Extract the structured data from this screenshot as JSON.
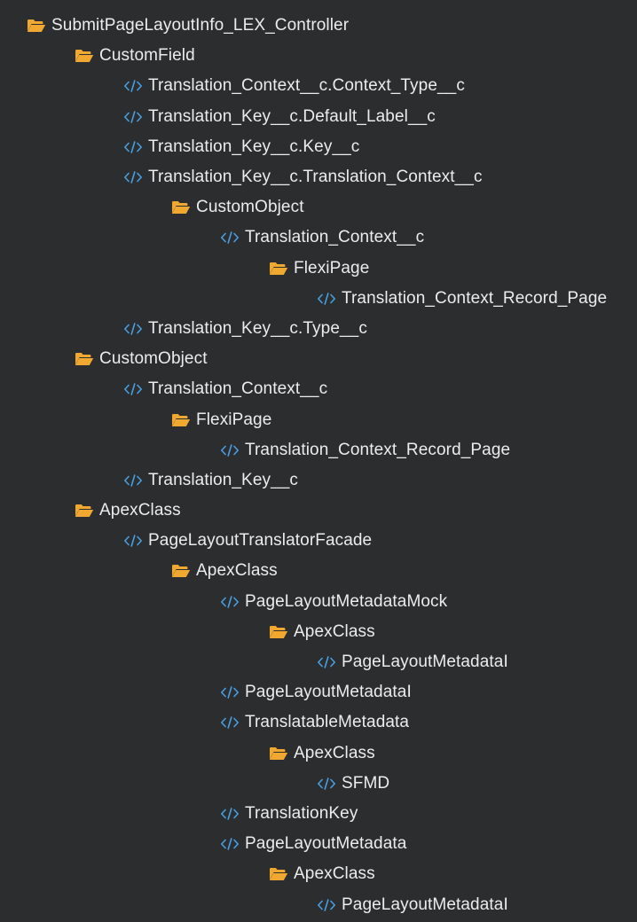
{
  "colors": {
    "background": "#2b2d2f",
    "folder_icon": "#f0a830",
    "code_icon": "#4a9ee0",
    "text": "#ececec"
  },
  "tree": [
    {
      "level": 0,
      "icon": "folder-icon",
      "label": "SubmitPageLayoutInfo_LEX_Controller"
    },
    {
      "level": 1,
      "icon": "folder-icon",
      "label": "CustomField"
    },
    {
      "level": 2,
      "icon": "code-icon",
      "label": "Translation_Context__c.Context_Type__c"
    },
    {
      "level": 2,
      "icon": "code-icon",
      "label": "Translation_Key__c.Default_Label__c"
    },
    {
      "level": 2,
      "icon": "code-icon",
      "label": "Translation_Key__c.Key__c"
    },
    {
      "level": 2,
      "icon": "code-icon",
      "label": "Translation_Key__c.Translation_Context__c"
    },
    {
      "level": 3,
      "icon": "folder-icon",
      "label": "CustomObject"
    },
    {
      "level": 4,
      "icon": "code-icon",
      "label": "Translation_Context__c"
    },
    {
      "level": 5,
      "icon": "folder-icon",
      "label": "FlexiPage"
    },
    {
      "level": 6,
      "icon": "code-icon",
      "label": "Translation_Context_Record_Page"
    },
    {
      "level": 2,
      "icon": "code-icon",
      "label": "Translation_Key__c.Type__c"
    },
    {
      "level": 1,
      "icon": "folder-icon",
      "label": "CustomObject"
    },
    {
      "level": 2,
      "icon": "code-icon",
      "label": "Translation_Context__c"
    },
    {
      "level": 3,
      "icon": "folder-icon",
      "label": "FlexiPage"
    },
    {
      "level": 4,
      "icon": "code-icon",
      "label": "Translation_Context_Record_Page"
    },
    {
      "level": 2,
      "icon": "code-icon",
      "label": "Translation_Key__c"
    },
    {
      "level": 1,
      "icon": "folder-icon",
      "label": "ApexClass"
    },
    {
      "level": 2,
      "icon": "code-icon",
      "label": "PageLayoutTranslatorFacade"
    },
    {
      "level": 3,
      "icon": "folder-icon",
      "label": "ApexClass"
    },
    {
      "level": 4,
      "icon": "code-icon",
      "label": "PageLayoutMetadataMock"
    },
    {
      "level": 5,
      "icon": "folder-icon",
      "label": "ApexClass"
    },
    {
      "level": 6,
      "icon": "code-icon",
      "label": "PageLayoutMetadataI"
    },
    {
      "level": 4,
      "icon": "code-icon",
      "label": "PageLayoutMetadataI"
    },
    {
      "level": 4,
      "icon": "code-icon",
      "label": "TranslatableMetadata"
    },
    {
      "level": 5,
      "icon": "folder-icon",
      "label": "ApexClass"
    },
    {
      "level": 6,
      "icon": "code-icon",
      "label": "SFMD"
    },
    {
      "level": 4,
      "icon": "code-icon",
      "label": "TranslationKey"
    },
    {
      "level": 4,
      "icon": "code-icon",
      "label": "PageLayoutMetadata"
    },
    {
      "level": 5,
      "icon": "folder-icon",
      "label": "ApexClass"
    },
    {
      "level": 6,
      "icon": "code-icon",
      "label": "PageLayoutMetadataI"
    }
  ]
}
